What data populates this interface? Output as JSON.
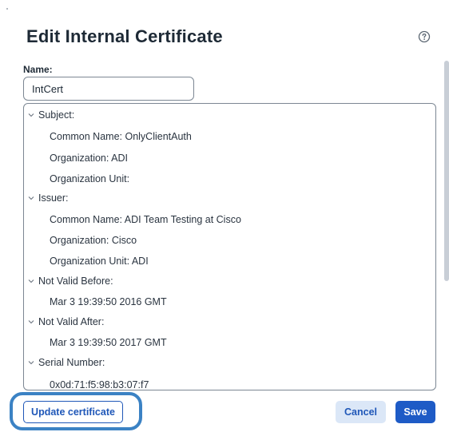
{
  "dialog": {
    "title": "Edit Internal Certificate",
    "help_icon": "question-circle-icon"
  },
  "name_field": {
    "label": "Name:",
    "value": "IntCert"
  },
  "certificate": {
    "sections": [
      {
        "label": "Subject:",
        "fields": [
          "Common Name: OnlyClientAuth",
          "Organization: ADI",
          "Organization Unit:"
        ]
      },
      {
        "label": "Issuer:",
        "fields": [
          "Common Name: ADI Team Testing at Cisco",
          "Organization: Cisco",
          "Organization Unit: ADI"
        ]
      },
      {
        "label": "Not Valid Before:",
        "fields": [
          "Mar 3 19:39:50 2016 GMT"
        ]
      },
      {
        "label": "Not Valid After:",
        "fields": [
          "Mar 3 19:39:50 2017 GMT"
        ]
      },
      {
        "label": "Serial Number:",
        "fields": [
          "0x0d:71:f5:98:b3:07:f7"
        ]
      }
    ]
  },
  "buttons": {
    "update": "Update certificate",
    "cancel": "Cancel",
    "save": "Save"
  },
  "colors": {
    "primary": "#1e5bc6",
    "highlight_ring": "#3b82c4",
    "cancel_bg": "#dbe7f7"
  }
}
